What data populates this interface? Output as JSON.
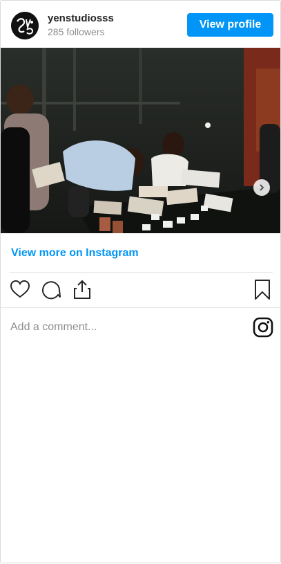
{
  "header": {
    "username": "yenstudiosss",
    "followers": "285 followers",
    "view_profile_label": "View profile"
  },
  "post": {
    "image_description_icon": "carousel-photo",
    "carousel": {
      "slides": 2,
      "current": 1
    }
  },
  "links": {
    "view_more": "View more on Instagram"
  },
  "actions": {
    "icons": [
      "heart-icon",
      "comment-icon",
      "share-icon",
      "bookmark-icon"
    ]
  },
  "comment": {
    "placeholder": "Add a comment..."
  },
  "colors": {
    "accent": "#0095f6",
    "text": "#262626",
    "muted": "#8e8e8e",
    "border": "#dbdbdb"
  }
}
